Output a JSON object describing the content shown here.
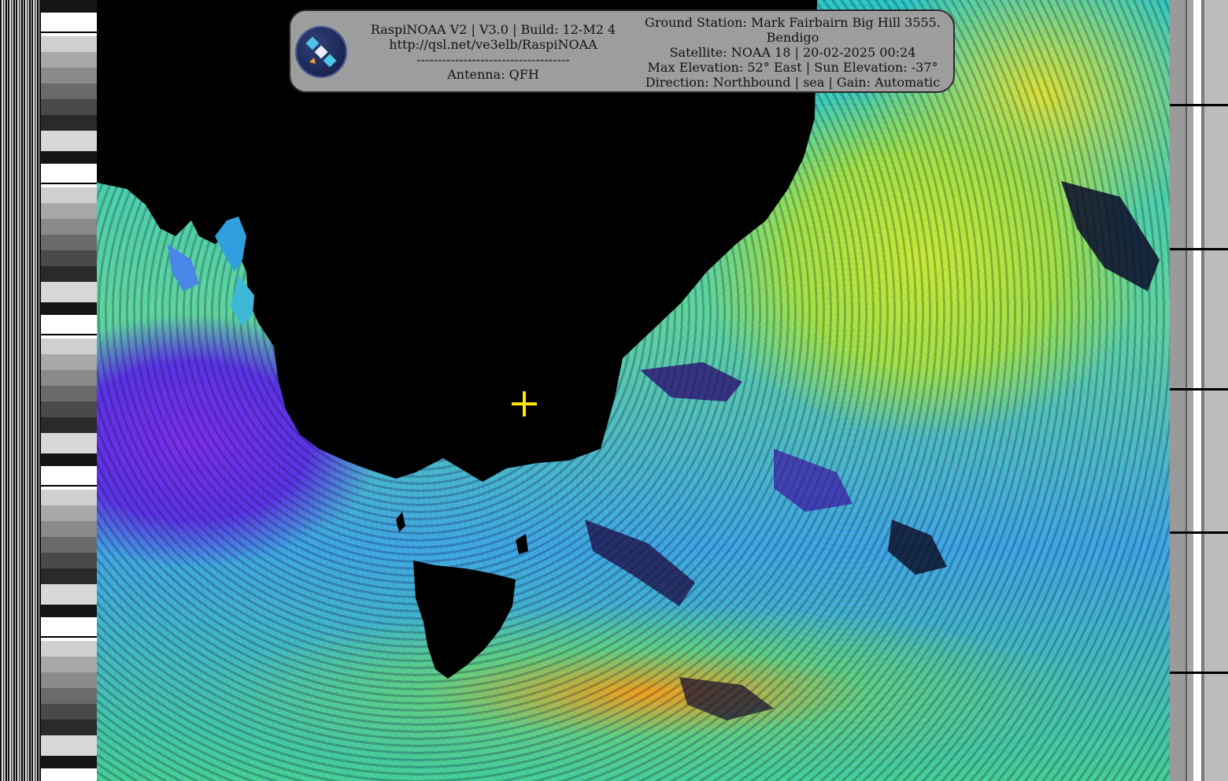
{
  "banner": {
    "left_lines": [
      "RaspiNOAA V2 | V3.0 | Build: 12-M2 4",
      "http://qsl.net/ve3elb/RaspiNOAA",
      "------------------------------------",
      "Antenna: QFH"
    ],
    "right_lines": [
      "Ground Station: Mark Fairbairn Big Hill 3555.",
      "Bendigo",
      "Satellite: NOAA 18 | 20-02-2025 00:24",
      "Max Elevation: 52° East | Sun Elevation: -37°",
      "Direction: Northbound | sea | Gain: Automatic"
    ],
    "logo_icon": "satellite-icon"
  },
  "image": {
    "type": "NOAA APT sea-surface false-color",
    "marker_icon": "crosshair-icon",
    "colors": {
      "land": "#000000",
      "marker": "#ffe600",
      "banner_bg": "#9d9d9d"
    }
  }
}
